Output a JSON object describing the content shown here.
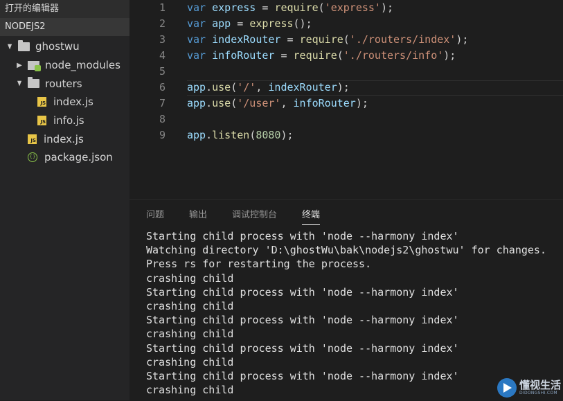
{
  "sidebar": {
    "open_editors": "打开的编辑器",
    "project": "NODEJS2",
    "tree": [
      {
        "label": "ghostwu",
        "indent": 0,
        "twisty": "▲",
        "icon": "folder"
      },
      {
        "label": "node_modules",
        "indent": 1,
        "twisty": "▶",
        "icon": "node-modules"
      },
      {
        "label": "routers",
        "indent": 1,
        "twisty": "▲",
        "icon": "folder"
      },
      {
        "label": "index.js",
        "indent": 2,
        "twisty": "",
        "icon": "js"
      },
      {
        "label": "info.js",
        "indent": 2,
        "twisty": "",
        "icon": "js"
      },
      {
        "label": "index.js",
        "indent": 1,
        "twisty": "",
        "icon": "js"
      },
      {
        "label": "package.json",
        "indent": 1,
        "twisty": "",
        "icon": "json"
      }
    ]
  },
  "icons": {
    "js_badge": "JS",
    "json_badge": "{}"
  },
  "editor": {
    "lines": [
      {
        "n": "1",
        "tokens": [
          [
            "kw",
            "var"
          ],
          [
            "op",
            " "
          ],
          [
            "id",
            "express"
          ],
          [
            "op",
            " = "
          ],
          [
            "fn",
            "require"
          ],
          [
            "op",
            "("
          ],
          [
            "str",
            "'express'"
          ],
          [
            "op",
            ");"
          ]
        ]
      },
      {
        "n": "2",
        "tokens": [
          [
            "kw",
            "var"
          ],
          [
            "op",
            " "
          ],
          [
            "id",
            "app"
          ],
          [
            "op",
            " = "
          ],
          [
            "fn",
            "express"
          ],
          [
            "op",
            "();"
          ]
        ]
      },
      {
        "n": "3",
        "tokens": [
          [
            "kw",
            "var"
          ],
          [
            "op",
            " "
          ],
          [
            "id",
            "indexRouter"
          ],
          [
            "op",
            " = "
          ],
          [
            "fn",
            "require"
          ],
          [
            "op",
            "("
          ],
          [
            "str",
            "'./routers/index'"
          ],
          [
            "op",
            ");"
          ]
        ]
      },
      {
        "n": "4",
        "tokens": [
          [
            "kw",
            "var"
          ],
          [
            "op",
            " "
          ],
          [
            "id",
            "infoRouter"
          ],
          [
            "op",
            " = "
          ],
          [
            "fn",
            "require"
          ],
          [
            "op",
            "("
          ],
          [
            "str",
            "'./routers/info'"
          ],
          [
            "op",
            ");"
          ]
        ]
      },
      {
        "n": "5",
        "tokens": []
      },
      {
        "n": "6",
        "tokens": [
          [
            "id",
            "app"
          ],
          [
            "op",
            "."
          ],
          [
            "fn",
            "use"
          ],
          [
            "op",
            "("
          ],
          [
            "str",
            "'/'"
          ],
          [
            "op",
            ", "
          ],
          [
            "id",
            "indexRouter"
          ],
          [
            "op",
            ");"
          ]
        ]
      },
      {
        "n": "7",
        "tokens": [
          [
            "id",
            "app"
          ],
          [
            "op",
            "."
          ],
          [
            "fn",
            "use"
          ],
          [
            "op",
            "("
          ],
          [
            "str",
            "'/user'"
          ],
          [
            "op",
            ", "
          ],
          [
            "id",
            "infoRouter"
          ],
          [
            "op",
            ");"
          ]
        ]
      },
      {
        "n": "8",
        "tokens": []
      },
      {
        "n": "9",
        "tokens": [
          [
            "id",
            "app"
          ],
          [
            "op",
            "."
          ],
          [
            "fn",
            "listen"
          ],
          [
            "op",
            "("
          ],
          [
            "num",
            "8080"
          ],
          [
            "op",
            ");"
          ]
        ]
      }
    ]
  },
  "panel": {
    "tabs": [
      {
        "label": "问题",
        "active": false
      },
      {
        "label": "输出",
        "active": false
      },
      {
        "label": "调试控制台",
        "active": false
      },
      {
        "label": "终端",
        "active": true
      }
    ],
    "terminal": [
      "Starting child process with 'node --harmony index'",
      "Watching directory 'D:\\ghostWu\\bak\\nodejs2\\ghostwu' for changes.",
      "Press rs for restarting the process.",
      "crashing child",
      "Starting child process with 'node --harmony index'",
      "crashing child",
      "Starting child process with 'node --harmony index'",
      "crashing child",
      "Starting child process with 'node --harmony index'",
      "crashing child",
      "Starting child process with 'node --harmony index'",
      "crashing child"
    ]
  },
  "watermark": {
    "title": "懂视生活",
    "sub": "DIDONGSHI.COM"
  },
  "colors": {
    "keyword": "#569cd6",
    "identifier": "#9cdcfe",
    "function": "#dcdcaa",
    "string": "#ce9178",
    "number": "#b5cea8"
  }
}
